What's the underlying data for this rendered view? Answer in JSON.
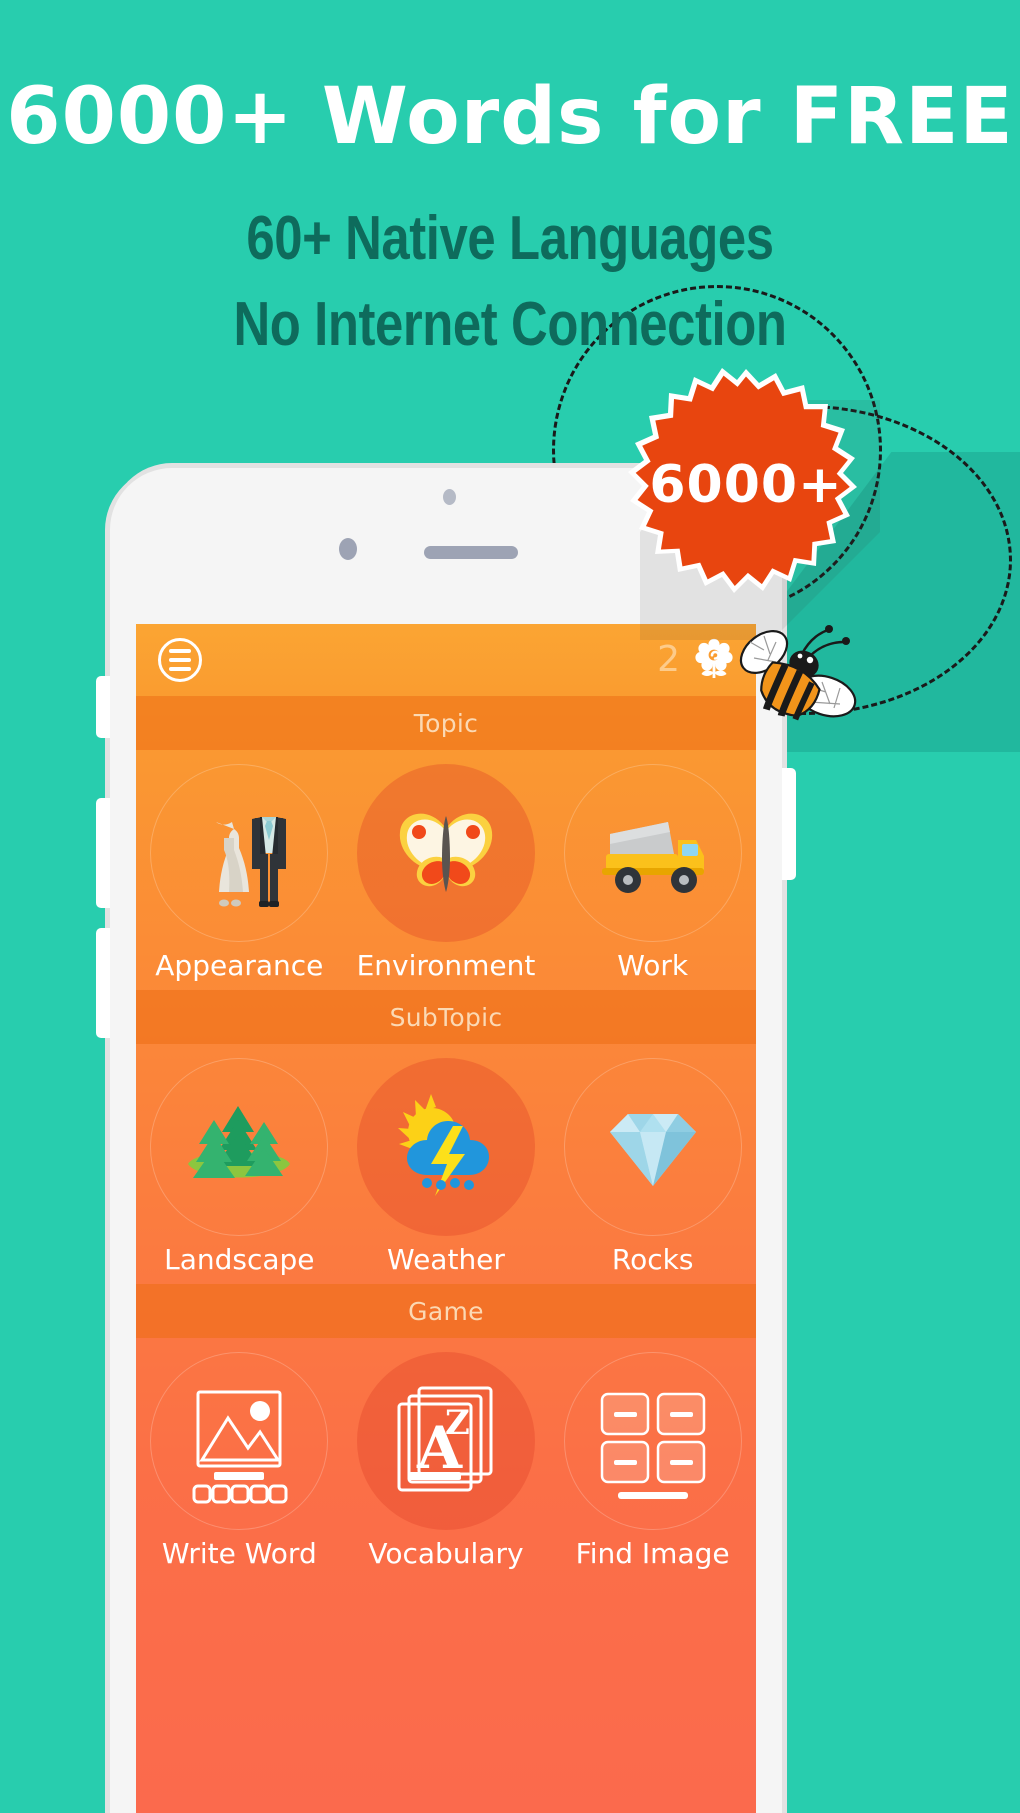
{
  "headline": {
    "line1": "6000+ Words  for FREE",
    "line2": "60+ Native Languages",
    "line3": "No Internet Connection"
  },
  "badge": {
    "label": "6000+"
  },
  "colors": {
    "background_teal": "#28CDAE",
    "headline_dark_teal": "#0E6B5C",
    "badge_orange": "#E8450F",
    "app_top_orange": "#FAA632",
    "app_bottom_coral": "#FB6A4D",
    "selected_tile": "#E05334",
    "band_text": "#FBD9B4"
  },
  "app": {
    "header": {
      "menu_icon": "hamburger-menu-icon",
      "flower_count": "2",
      "flower_icon": "flower-icon"
    },
    "sections": [
      {
        "title": "Topic",
        "items": [
          {
            "label": "Appearance",
            "icon": "dress-and-suit-icon",
            "selected": false
          },
          {
            "label": "Environment",
            "icon": "butterfly-icon",
            "selected": true
          },
          {
            "label": "Work",
            "icon": "dump-truck-icon",
            "selected": false
          }
        ]
      },
      {
        "title": "SubTopic",
        "items": [
          {
            "label": "Landscape",
            "icon": "pine-trees-icon",
            "selected": false
          },
          {
            "label": "Weather",
            "icon": "sun-cloud-storm-icon",
            "selected": true
          },
          {
            "label": "Rocks",
            "icon": "diamond-gem-icon",
            "selected": false
          }
        ]
      },
      {
        "title": "Game",
        "items": [
          {
            "label": "Write Word",
            "icon": "picture-frame-icon",
            "selected": false
          },
          {
            "label": "Vocabulary",
            "icon": "az-flashcards-icon",
            "selected": true
          },
          {
            "label": "Find Image",
            "icon": "tile-grid-icon",
            "selected": false
          }
        ]
      }
    ]
  }
}
